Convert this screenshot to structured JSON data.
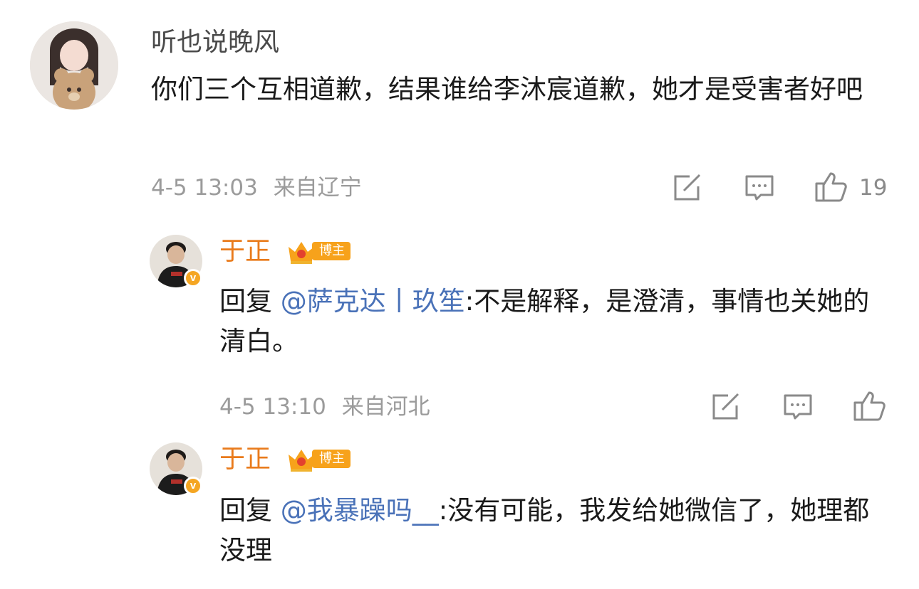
{
  "comments": [
    {
      "username": "听也说晚风",
      "text": "你们三个互相道歉，结果谁给李沐宸道歉，她才是受害者好吧",
      "time": "4-5 13:03",
      "location": "来自辽宁",
      "likes": "19"
    },
    {
      "username": "于正",
      "badge": "博主",
      "reply_prefix": "回复 ",
      "mention": "@萨克达丨玖笙",
      "text": ":不是解释，是澄清，事情也关她的清白。",
      "time": "4-5 13:10",
      "location": "来自河北"
    },
    {
      "username": "于正",
      "badge": "博主",
      "reply_prefix": "回复 ",
      "mention": "@我暴躁吗__",
      "text": ":没有可能，我发给她微信了，她理都没理"
    }
  ],
  "icons": {
    "share": "share-icon",
    "comment": "comment-icon",
    "like": "like-icon",
    "verified": "verified-v-icon",
    "crown": "crown-icon"
  },
  "colors": {
    "mention": "#4a72b8",
    "host_name": "#e97b1c",
    "badge": "#f7a21b",
    "meta": "#9b9b9b"
  }
}
